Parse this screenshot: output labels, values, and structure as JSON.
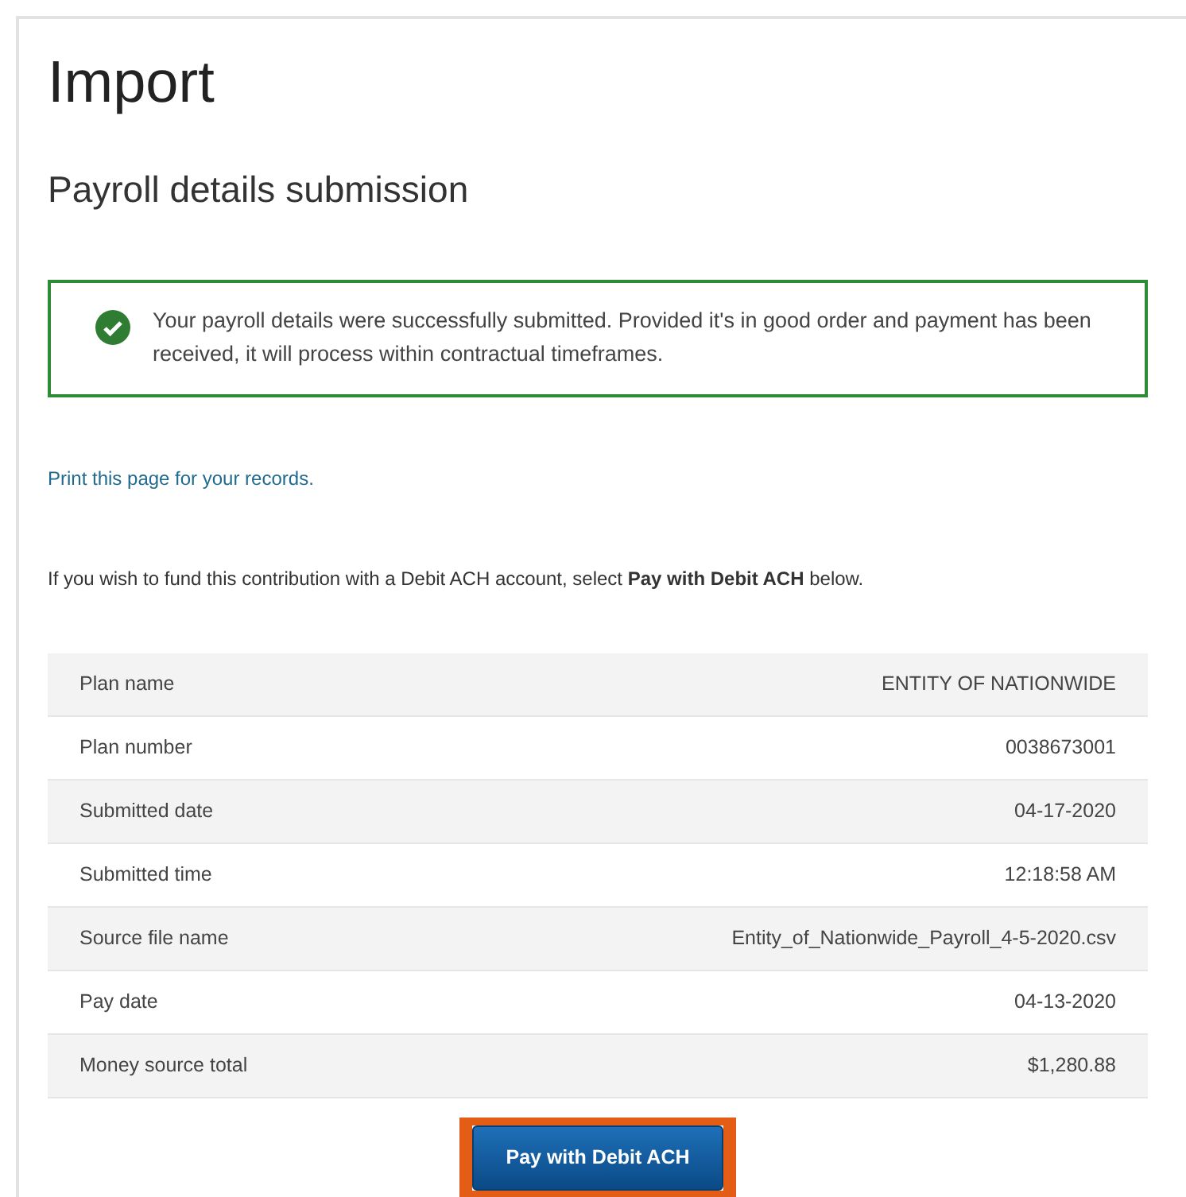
{
  "page": {
    "title": "Import",
    "subtitle": "Payroll details submission"
  },
  "alert": {
    "kind": "success",
    "message": "Your payroll details were successfully submitted. Provided it's in good order and payment has been received, it will process within contractual timeframes."
  },
  "print_link": "Print this page for your records.",
  "instruction": "If you wish to fund this contribution with a Debit ACH account, select **Pay with Debit ACH** below.",
  "details": [
    {
      "label": "Plan name",
      "value": "ENTITY OF NATIONWIDE"
    },
    {
      "label": "Plan number",
      "value": "0038673001"
    },
    {
      "label": "Submitted date",
      "value": "04-17-2020"
    },
    {
      "label": "Submitted time",
      "value": "12:18:58 AM"
    },
    {
      "label": "Source file name",
      "value": "Entity_of_Nationwide_Payroll_4-5-2020.csv"
    },
    {
      "label": "Pay date",
      "value": "04-13-2020"
    },
    {
      "label": "Money source total",
      "value": "$1,280.88"
    }
  ],
  "button": {
    "label": "Pay with Debit ACH",
    "highlighted": true
  }
}
